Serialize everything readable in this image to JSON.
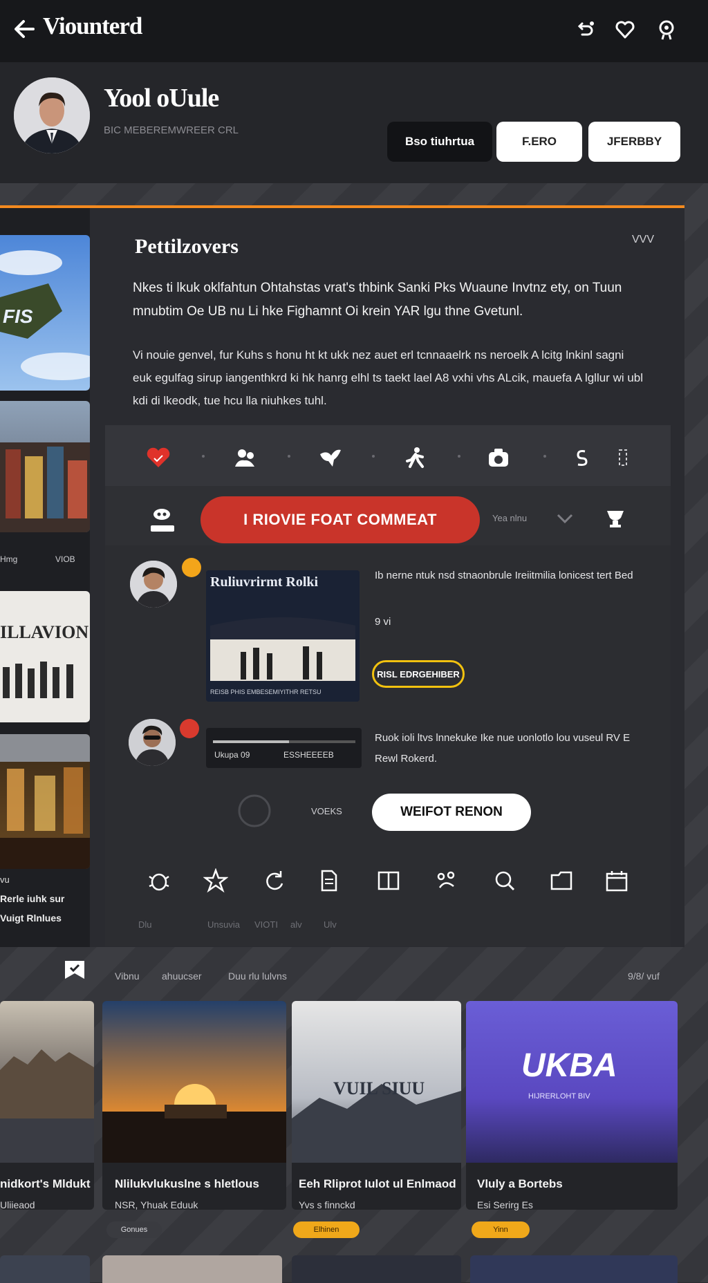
{
  "topbar": {
    "title": "Viounterd",
    "icons": [
      "back-arrow-icon",
      "share-icon",
      "heart-icon",
      "settings-icon"
    ]
  },
  "profile": {
    "name": "Yool oUule",
    "subtitle": "BIC MEBEREMWREER CRL",
    "buttons": [
      "Bso tiuhrtua",
      "F.ERO",
      "JFERBBY"
    ]
  },
  "panel": {
    "title": "Pettilzovers",
    "menu": "VVV",
    "description_1": "Nkes ti lkuk oklfahtun Ohtahstas vrat's thbink Sanki Pks Wuaune Invtnz ety, on Tuun mnubtim Oe UB nu Li hke Fighamnt Oi krein YAR lgu thne Gvetunl.",
    "description_2": "Vi nouie genvel, fur Kuhs s honu ht kt ukk nez auet erl tcnnaaelrk ns neroelk A lcitg lnkinl sagni euk egulfag sirup iangenthkrd ki hk hanrg elhl ts taekt lael A8 vxhi vhs ALcik, mauefa A lgllur wi ubl kdi di lkeodk, tue hcu lla niuhkes tuhl."
  },
  "reactions": [
    "heart-icon",
    "people-icon",
    "bird-icon",
    "run-icon",
    "camera-icon",
    "dollar-icon",
    "tag-icon"
  ],
  "comment_bar": {
    "left_icon": "user-icon",
    "button": "I RIOVIE FOAT COMMEAT",
    "side_text": "Yea nlnu",
    "chevron": "chevron-down-icon",
    "trophy": "trophy-icon"
  },
  "posts": [
    {
      "image_title": "Ruliuvrirmt Rolki",
      "image_caption": "REISB PHIS EMBESEMIYITHR RETSU",
      "text": "Ib nerne ntuk nsd stnaonbrule Ireiitmilia lonicest tert Bed",
      "meta": "9 vi",
      "pill": "RISL EDRGEHIBER"
    },
    {
      "bar_left": "Ukupa 09",
      "bar_right": "ESSHEEEEB",
      "text": "Ruok ioli ltvs lnnekuke Ike nue uonlotlo lou vuseul RV E Rewl Rokerd.",
      "small": "VOEKS",
      "cta": "WEIFOT RENON"
    }
  ],
  "toolbar": {
    "icons": [
      "bug-icon",
      "star-icon",
      "refresh-icon",
      "document-icon",
      "book-icon",
      "paw-icon",
      "search-icon",
      "folder-icon",
      "calendar-icon"
    ],
    "labels": [
      "Dlu",
      "Unsuvia",
      "VIOTI",
      "alv",
      "Ulv"
    ]
  },
  "left_column": {
    "thumb_labels": [
      "FIS",
      "ILLAVION"
    ],
    "meta_left": "Hmg",
    "meta_right": "VIOB",
    "caption_1": "vu",
    "caption_2": "Rerle iuhk sur",
    "caption_3": "Vuigt Rlnlues"
  },
  "section_row": {
    "left": "Vibnu",
    "middle": "ahuucser",
    "right_text": "Duu rlu lulvns",
    "counter": "9/8/ vuf"
  },
  "grid": [
    {
      "title": "nidkort's Mldukt",
      "sub": "Uliieaod",
      "tag": ""
    },
    {
      "title": "Nlilukvlukuslne s hletlous",
      "sub": "NSR, Yhuak Eduuk",
      "tag": "Gonues"
    },
    {
      "title": "Eeh Rliprot Iulot ul Enlmaod",
      "sub": "Yvs s finnckd",
      "tag": "Elhinen",
      "image_text": "VUIL SIUU"
    },
    {
      "title": "Vluly a Bortebs",
      "sub": "Esi Serirg Es",
      "tag": "Yinn",
      "image_text": "UKBA",
      "image_sub": "HIJRERLOHT BIV"
    }
  ],
  "colors": {
    "accent_orange": "#f38a1f",
    "comment_red": "#c9342a",
    "pill_yellow": "#f2c20f",
    "tag_amber": "#f0a81a"
  }
}
